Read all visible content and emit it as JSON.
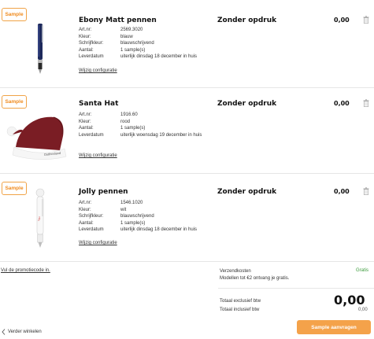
{
  "items": [
    {
      "badge": "Sample",
      "name": "Ebony Matt pennen",
      "imprint": "Zonder opdruk",
      "price": "0,00",
      "specs": [
        {
          "k": "Art.nr:",
          "v": "2569.3020"
        },
        {
          "k": "Kleur:",
          "v": "blauw"
        },
        {
          "k": "Schrijfkleur:",
          "v": "blauwschrijvend"
        },
        {
          "k": "Aantal:",
          "v": "1  sample(s)"
        },
        {
          "k": "Leverdatum",
          "v": "uiterlijk dinsdag 18 december in huis"
        }
      ],
      "edit_link": "Wijzig configuratie"
    },
    {
      "badge": "Sample",
      "name": "Santa Hat",
      "imprint": "Zonder opdruk",
      "price": "0,00",
      "specs": [
        {
          "k": "Art.nr:",
          "v": "1916.60"
        },
        {
          "k": "Kleur:",
          "v": "rood"
        },
        {
          "k": "Aantal:",
          "v": "1  sample(s)"
        },
        {
          "k": "Leverdatum",
          "v": "uiterlijk woensdag 19 december in huis"
        }
      ],
      "edit_link": "Wijzig configuratie"
    },
    {
      "badge": "Sample",
      "name": "Jolly pennen",
      "imprint": "Zonder opdruk",
      "price": "0,00",
      "specs": [
        {
          "k": "Art.nr:",
          "v": "1546.1020"
        },
        {
          "k": "Kleur:",
          "v": "wit"
        },
        {
          "k": "Schrijfkleur:",
          "v": "blauwschrijvend"
        },
        {
          "k": "Aantal:",
          "v": "1  sample(s)"
        },
        {
          "k": "Leverdatum",
          "v": "uiterlijk dinsdag 18 december in huis"
        }
      ],
      "edit_link": "Wijzig configuratie"
    }
  ],
  "promo_link": "Vul de promotiecode in.",
  "shipping": {
    "label": "Verzendkosten",
    "note": "Modellen tot €2 ontvang je gratis.",
    "price": "Gratis"
  },
  "totals": {
    "excl_label": "Totaal exclusief btw",
    "incl_label": "Totaal inclusief btw",
    "excl_value": "0,00",
    "incl_value": "0,00"
  },
  "continue_label": "Verder winkelen",
  "cta_label": "Sample aanvragen",
  "colors": {
    "accent": "#f4a24a",
    "badge_border": "#f0a347",
    "free_green": "#3a9a3a"
  }
}
